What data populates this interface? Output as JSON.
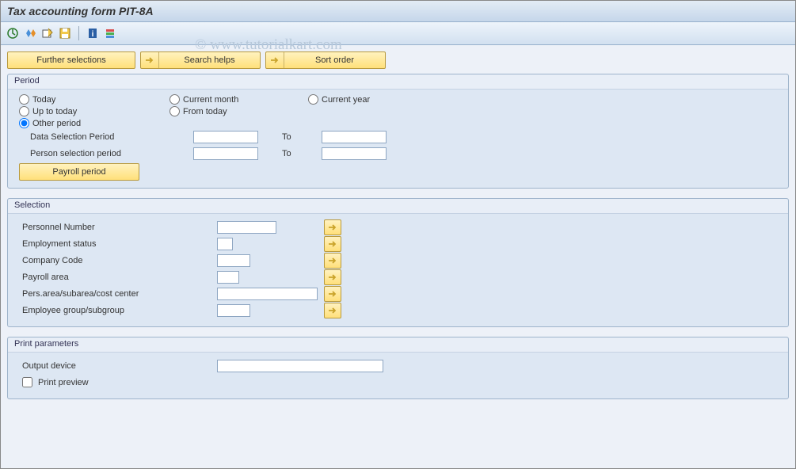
{
  "title": "Tax accounting form PIT-8A",
  "watermark": "© www.tutorialkart.com",
  "buttons": {
    "further": "Further selections",
    "search": "Search helps",
    "sort": "Sort order",
    "payroll": "Payroll period"
  },
  "period": {
    "header": "Period",
    "today": "Today",
    "current_month": "Current month",
    "current_year": "Current year",
    "up_to_today": "Up to today",
    "from_today": "From today",
    "other": "Other period",
    "data_sel": "Data Selection Period",
    "person_sel": "Person selection period",
    "to": "To"
  },
  "selection": {
    "header": "Selection",
    "persno": "Personnel Number",
    "emp_status": "Employment status",
    "company": "Company Code",
    "payarea": "Payroll area",
    "persarea": "Pers.area/subarea/cost center",
    "empgroup": "Employee group/subgroup"
  },
  "print": {
    "header": "Print parameters",
    "output": "Output device",
    "preview": "Print preview"
  }
}
